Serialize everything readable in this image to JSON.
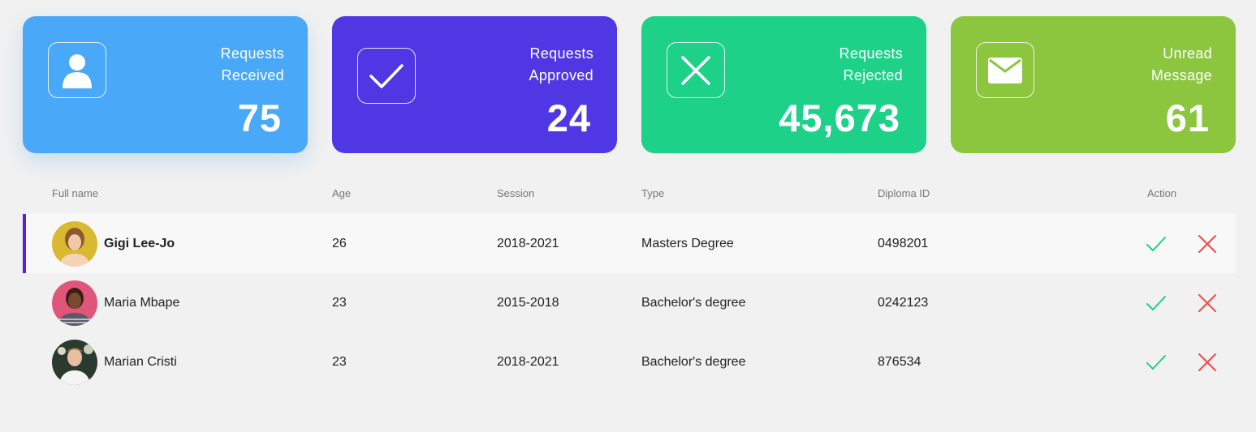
{
  "cards": [
    {
      "label": "Requests\nReceived",
      "value": "75",
      "color": "#4aa8f9",
      "icon": "user-icon"
    },
    {
      "label": "Requests\nApproved",
      "value": "24",
      "color": "#4f37e3",
      "icon": "check-icon"
    },
    {
      "label": "Requests\nRejected",
      "value": "45,673",
      "color": "#1ed188",
      "icon": "close-icon"
    },
    {
      "label": "Unread\nMessage",
      "value": "61",
      "color": "#8cc63f",
      "icon": "envelope-icon"
    }
  ],
  "table": {
    "headers": [
      "Full name",
      "Age",
      "Session",
      "Type",
      "Diploma ID",
      "Action"
    ],
    "rows": [
      {
        "name": "Gigi Lee-Jo",
        "age": "26",
        "session": "2018-2021",
        "type": "Masters Degree",
        "diploma": "0498201",
        "selected": true
      },
      {
        "name": "Maria Mbape",
        "age": "23",
        "session": "2015-2018",
        "type": "Bachelor's degree",
        "diploma": "0242123",
        "selected": false
      },
      {
        "name": "Marian Cristi",
        "age": "23",
        "session": "2018-2021",
        "type": "Bachelor's degree",
        "diploma": "876534",
        "selected": false
      }
    ]
  },
  "colors": {
    "approve": "#1ed188",
    "reject": "#f04a4a",
    "selected_accent": "#5a1fe0"
  }
}
